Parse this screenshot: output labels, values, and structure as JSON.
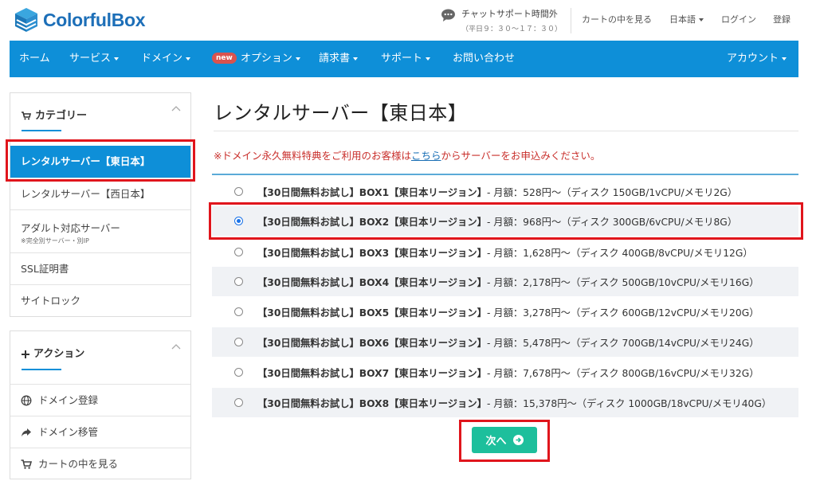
{
  "header": {
    "logo_text": "ColorfulBox",
    "chat_main": "チャットサポート時間外",
    "chat_sub": "（平日９：３０～１７：３０）",
    "links": {
      "cart": "カートの中を見る",
      "language": "日本語",
      "login": "ログイン",
      "register": "登録"
    }
  },
  "nav": {
    "items": [
      "ホーム",
      "サービス",
      "ドメイン",
      "オプション",
      "請求書",
      "サポート",
      "お問い合わせ"
    ],
    "new_badge": "new",
    "account": "アカウント"
  },
  "sidebar": {
    "category_title": "カテゴリー",
    "categories": [
      {
        "label": "レンタルサーバー【東日本】"
      },
      {
        "label": "レンタルサーバー【西日本】"
      },
      {
        "label": "アダルト対応サーバー",
        "sub": "※完全別サーバー・別IP"
      },
      {
        "label": "SSL証明書"
      },
      {
        "label": "サイトロック"
      }
    ],
    "action_title": "アクション",
    "actions": [
      "ドメイン登録",
      "ドメイン移管",
      "カートの中を見る"
    ]
  },
  "main": {
    "title": "レンタルサーバー【東日本】",
    "notice_before": "※ドメイン永久無料特典をご利用のお客様は",
    "notice_link": "こちら",
    "notice_after": "からサーバーをお申込みください。",
    "plans": [
      {
        "name": "【30日間無料お試し】BOX1【東日本リージョン】",
        "detail": " - 月額：528円〜（ディスク 150GB/1vCPU/メモリ2G）"
      },
      {
        "name": "【30日間無料お試し】BOX2【東日本リージョン】",
        "detail": " - 月額：968円〜（ディスク 300GB/6vCPU/メモリ8G）"
      },
      {
        "name": "【30日間無料お試し】BOX3【東日本リージョン】",
        "detail": " - 月額：1,628円〜（ディスク 400GB/8vCPU/メモリ12G）"
      },
      {
        "name": "【30日間無料お試し】BOX4【東日本リージョン】",
        "detail": " - 月額：2,178円〜（ディスク 500GB/10vCPU/メモリ16G）"
      },
      {
        "name": "【30日間無料お試し】BOX5【東日本リージョン】",
        "detail": " - 月額：3,278円〜（ディスク 600GB/12vCPU/メモリ20G）"
      },
      {
        "name": "【30日間無料お試し】BOX6【東日本リージョン】",
        "detail": " - 月額：5,478円〜（ディスク 700GB/14vCPU/メモリ24G）"
      },
      {
        "name": "【30日間無料お試し】BOX7【東日本リージョン】",
        "detail": " - 月額：7,678円〜（ディスク 800GB/16vCPU/メモリ32G）"
      },
      {
        "name": "【30日間無料お試し】BOX8【東日本リージョン】",
        "detail": " - 月額：15,378円〜（ディスク 1000GB/18vCPU/メモリ40G）"
      }
    ],
    "selected_plan": "BOX2",
    "next_label": "次へ"
  },
  "colors": {
    "accent": "#0e8fd8",
    "next_button": "#1dbf9c",
    "notice": "#c9302c",
    "highlight_box": "#e0151c"
  }
}
